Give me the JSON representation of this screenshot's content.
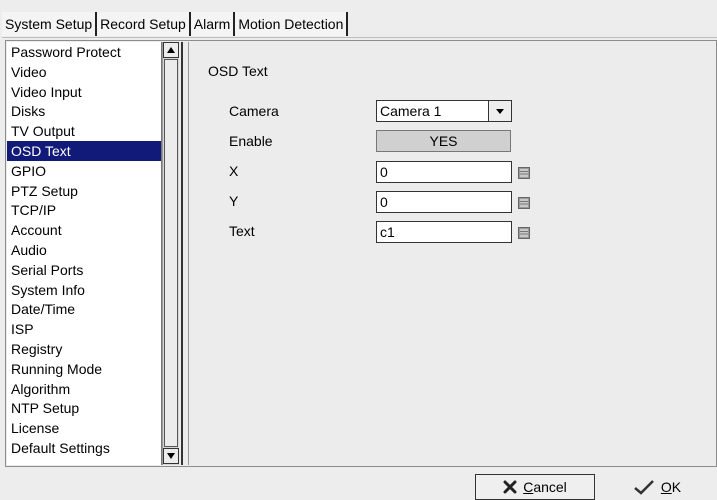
{
  "tabs": [
    {
      "label": "System Setup"
    },
    {
      "label": "Record Setup"
    },
    {
      "label": "Alarm"
    },
    {
      "label": "Motion Detection"
    }
  ],
  "sidebar": {
    "selected": "OSD Text",
    "items": [
      {
        "label": "Password Protect"
      },
      {
        "label": "Video"
      },
      {
        "label": "Video Input"
      },
      {
        "label": "Disks"
      },
      {
        "label": "TV Output"
      },
      {
        "label": "OSD Text"
      },
      {
        "label": "GPIO"
      },
      {
        "label": "PTZ Setup"
      },
      {
        "label": "TCP/IP"
      },
      {
        "label": "Account"
      },
      {
        "label": "Audio"
      },
      {
        "label": "Serial Ports"
      },
      {
        "label": "System Info"
      },
      {
        "label": "Date/Time"
      },
      {
        "label": "ISP"
      },
      {
        "label": "Registry"
      },
      {
        "label": "Running Mode"
      },
      {
        "label": "Algorithm"
      },
      {
        "label": "NTP Setup"
      },
      {
        "label": "License"
      },
      {
        "label": "Default Settings"
      }
    ]
  },
  "content": {
    "title": "OSD Text",
    "camera_label": "Camera",
    "camera_value": "Camera 1",
    "enable_label": "Enable",
    "enable_value": "YES",
    "x_label": "X",
    "x_value": "0",
    "y_label": "Y",
    "y_value": "0",
    "text_label": "Text",
    "text_value": "c1"
  },
  "buttons": {
    "cancel_first": "C",
    "cancel_rest": "ancel",
    "ok_first": "O",
    "ok_rest": "K"
  },
  "colors": {
    "selection": "#111a78",
    "background": "#ededed"
  }
}
